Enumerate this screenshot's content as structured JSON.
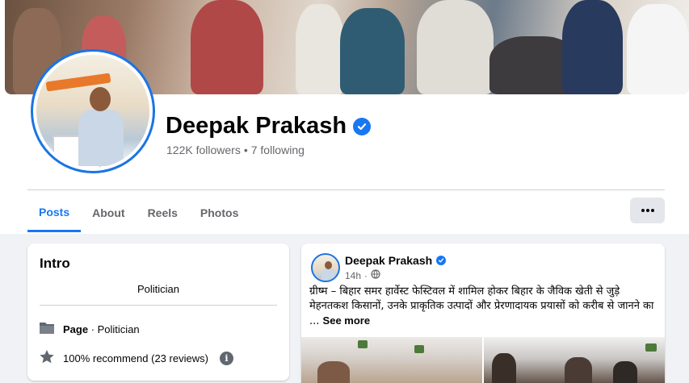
{
  "profile": {
    "name": "Deepak Prakash",
    "followers": "122K followers",
    "separator": "•",
    "following": "7 following"
  },
  "tabs": [
    {
      "label": "Posts"
    },
    {
      "label": "About"
    },
    {
      "label": "Reels"
    },
    {
      "label": "Photos"
    }
  ],
  "more_button_icon": "more-dots-icon",
  "intro": {
    "title": "Intro",
    "bio": "Politician",
    "page_label": "Page",
    "page_category": " · Politician",
    "recommend": "100% recommend (23 reviews)",
    "info_glyph": "i"
  },
  "post": {
    "author": "Deepak Prakash",
    "time": "14h",
    "separator": "·",
    "privacy_icon": "globe-icon",
    "text": "ग्रीष्म – बिहार समर हार्वेस्ट फेस्टिवल में शामिल होकर बिहार के जैविक खेती से जुड़े मेहनतकश किसानों, उनके प्राकृतिक उत्पादों और प्रेरणादायक प्रयासों को करीब से जानने का ...",
    "see_more": "See more"
  },
  "colors": {
    "accent": "#1877f2",
    "background": "#f0f2f5",
    "muted_text": "#65676b"
  }
}
